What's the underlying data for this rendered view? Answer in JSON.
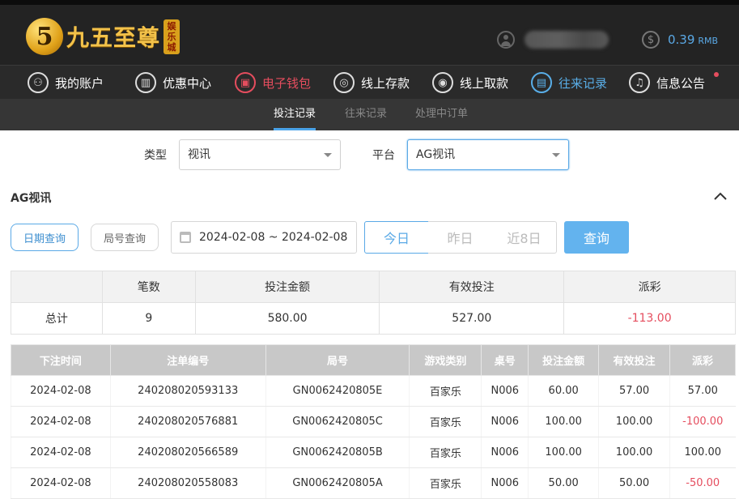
{
  "brand": {
    "logo_char": "5",
    "name": "九五至尊",
    "tag": "娱乐城"
  },
  "account": {
    "balance": "0.39",
    "currency": "RMB"
  },
  "nav": [
    {
      "label": "我的账户",
      "icon": "user-icon",
      "glyph": "⚇"
    },
    {
      "label": "优惠中心",
      "icon": "gift-icon",
      "glyph": "▥"
    },
    {
      "label": "电子钱包",
      "icon": "wallet-icon",
      "glyph": "▣"
    },
    {
      "label": "线上存款",
      "icon": "deposit-icon",
      "glyph": "◎"
    },
    {
      "label": "线上取款",
      "icon": "withdraw-icon",
      "glyph": "◉"
    },
    {
      "label": "往来记录",
      "icon": "record-icon",
      "glyph": "▤"
    },
    {
      "label": "信息公告",
      "icon": "bell-icon",
      "glyph": "♫"
    }
  ],
  "subnav": [
    "投注记录",
    "往来记录",
    "处理中订单"
  ],
  "filters": {
    "type_label": "类型",
    "type_value": "视讯",
    "platform_label": "平台",
    "platform_value": "AG视讯"
  },
  "section_title": "AG视讯",
  "query": {
    "by_date": "日期查询",
    "by_round": "局号查询",
    "date_range": "2024-02-08 ~ 2024-02-08",
    "today": "今日",
    "yesterday": "昨日",
    "last8": "近8日",
    "search": "查询"
  },
  "summary": {
    "headers": [
      "",
      "笔数",
      "投注金额",
      "有效投注",
      "派彩"
    ],
    "row": [
      "总计",
      "9",
      "580.00",
      "527.00",
      "-113.00"
    ]
  },
  "details": {
    "headers": [
      "下注时间",
      "注单编号",
      "局号",
      "游戏类别",
      "桌号",
      "投注金额",
      "有效投注",
      "派彩"
    ],
    "rows": [
      [
        "2024-02-08",
        "240208020593133",
        "GN0062420805E",
        "百家乐",
        "N006",
        "60.00",
        "57.00",
        "57.00"
      ],
      [
        "2024-02-08",
        "240208020576881",
        "GN0062420805C",
        "百家乐",
        "N006",
        "100.00",
        "100.00",
        "-100.00"
      ],
      [
        "2024-02-08",
        "240208020566589",
        "GN0062420805B",
        "百家乐",
        "N006",
        "100.00",
        "100.00",
        "100.00"
      ],
      [
        "2024-02-08",
        "240208020558083",
        "GN0062420805A",
        "百家乐",
        "N006",
        "50.00",
        "50.00",
        "-50.00"
      ]
    ]
  }
}
